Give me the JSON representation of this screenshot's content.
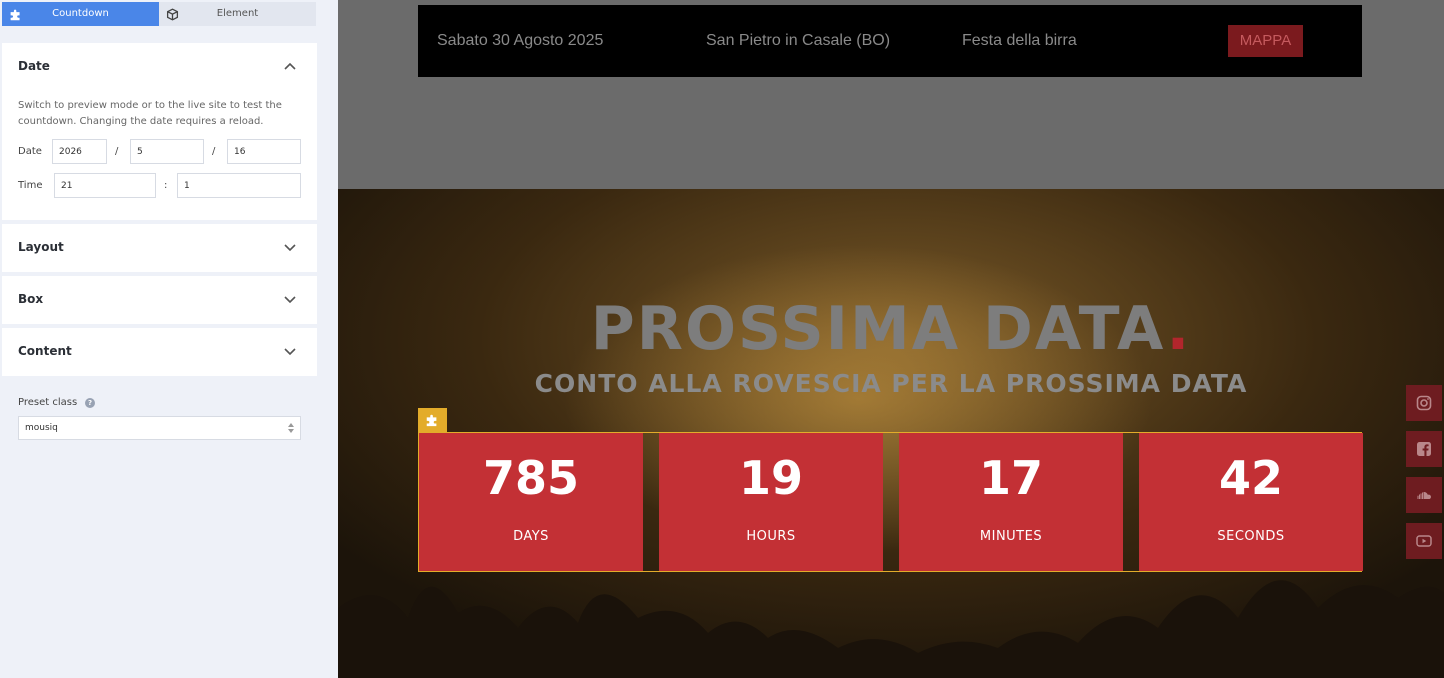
{
  "tabs": [
    {
      "label": "Countdown",
      "icon": "puzzle-icon",
      "active": true
    },
    {
      "label": "Element",
      "icon": "cube-icon",
      "active": false
    }
  ],
  "panel": {
    "date_section": {
      "title": "Date",
      "description": "Switch to preview mode or to the live site to test the countdown. Changing the date requires a reload.",
      "date_label": "Date",
      "year": "2026",
      "month": "5",
      "day": "16",
      "date_separator": "/",
      "time_label": "Time",
      "hour": "21",
      "minute": "1",
      "time_separator": ":"
    },
    "layout_title": "Layout",
    "box_title": "Box",
    "content_title": "Content",
    "preset_label": "Preset class",
    "preset_value": "mousiq"
  },
  "preview": {
    "topbar": {
      "date": "Sabato 30 Agosto 2025",
      "location": "San Pietro in Casale (BO)",
      "event": "Festa della birra",
      "map_button": "MAPPA"
    },
    "hero": {
      "title": "PROSSIMA DATA",
      "title_dot": ".",
      "subtitle": "CONTO ALLA ROVESCIA PER LA PROSSIMA DATA"
    },
    "countdown": [
      {
        "value": "785",
        "label": "DAYS"
      },
      {
        "value": "19",
        "label": "HOURS"
      },
      {
        "value": "17",
        "label": "MINUTES"
      },
      {
        "value": "42",
        "label": "SECONDS"
      }
    ],
    "social": [
      "instagram-icon",
      "facebook-icon",
      "soundcloud-icon",
      "youtube-icon"
    ]
  },
  "colors": {
    "accent_blue": "#4a86e8",
    "countdown_red": "#c33035",
    "badge_yellow": "#e3ac2a",
    "social_red": "#6e1c20"
  }
}
